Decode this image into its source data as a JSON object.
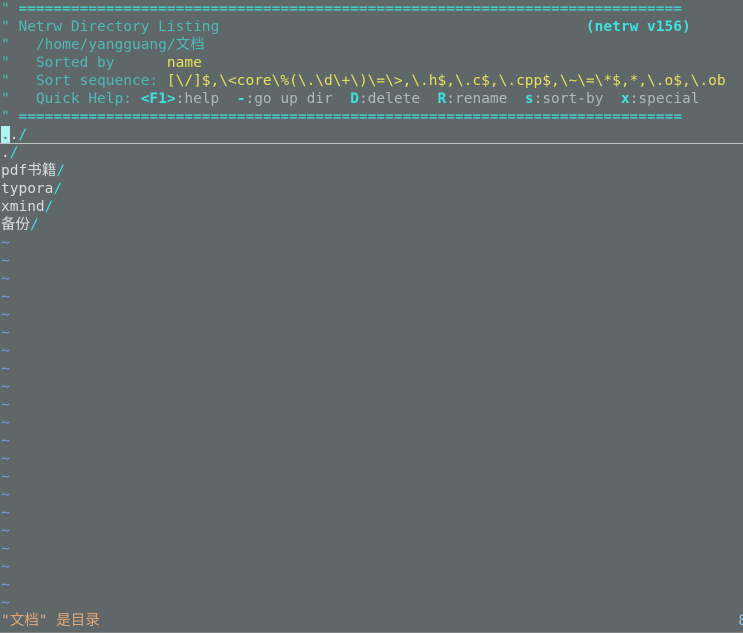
{
  "app": {
    "name": "netrw-directory-listing",
    "background_color": "#5f6769",
    "banner_color": "#4fb8b8",
    "accent_color": "#3fe0e0",
    "message_color": "#e0a878"
  },
  "banner": {
    "quote_char": "\"",
    "separator": "============================================================================",
    "title": "Netrw Directory Listing",
    "version": "(netrw v156)",
    "path": "/home/yangguang/文档",
    "sorted_by_label": "Sorted by",
    "sorted_by_value": "name",
    "sort_sequence_label": "Sort sequence:",
    "sort_sequence_value": "[\\/]$,\\<core\\%(\\.\\d\\+\\)\\=\\>,\\.h$,\\.c$,\\.cpp$,\\~\\=\\*$,*,\\.o$,\\.ob",
    "quick_help_label": "Quick Help:",
    "quick_help_items": [
      {
        "key": "<F1>",
        "action": ":help"
      },
      {
        "key": "-",
        "action": ":go up dir"
      },
      {
        "key": "D",
        "action": ":delete"
      },
      {
        "key": "R",
        "action": ":rename"
      },
      {
        "key": "s",
        "action": ":sort-by"
      },
      {
        "key": "x",
        "action": ":special"
      }
    ]
  },
  "files": [
    {
      "name": "..",
      "slash": "/",
      "cursor": true
    },
    {
      "name": ".",
      "slash": "/",
      "cursor": false
    },
    {
      "name": "pdf书籍",
      "slash": "/",
      "cursor": false
    },
    {
      "name": "typora",
      "slash": "/",
      "cursor": false
    },
    {
      "name": "xmind",
      "slash": "/",
      "cursor": false
    },
    {
      "name": "备份",
      "slash": "/",
      "cursor": false
    }
  ],
  "empty_marker": "~",
  "empty_line_count": 21,
  "status": {
    "message": "\"文档\" 是目录",
    "right_fragment": "8"
  }
}
